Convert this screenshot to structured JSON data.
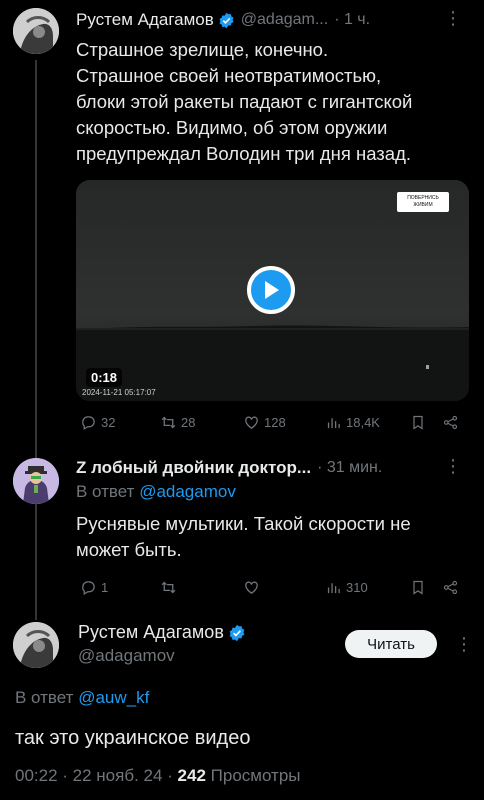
{
  "tweet1": {
    "author": "Рустем Адагамов",
    "handle": "@adagam...",
    "time": "· 1 ч.",
    "text_lines": [
      "Страшное зрелище, конечно.",
      "Страшное своей неотвратимостью,",
      "блоки этой ракеты падают с гигантской",
      "скоростью. Видимо, об этом оружии",
      "предупреждал Володин три дня назад."
    ],
    "video": {
      "duration": "0:18",
      "timestamp": "2024-11-21 05:17:07",
      "watermark_line1": "ПОВЕРНИСЬ",
      "watermark_line2": "ЖИВИМ"
    },
    "stats": {
      "replies": "32",
      "reposts": "28",
      "likes": "128",
      "views": "18,4K"
    }
  },
  "tweet2": {
    "author": "Z лобный двойник доктор...",
    "time": "· 31 мин.",
    "reply_prefix": "В ответ",
    "reply_to": "@adagamov",
    "text_lines": [
      "Руснявые мультики. Такой скорости не",
      "может быть."
    ],
    "stats": {
      "replies": "1",
      "reposts": "",
      "likes": "",
      "views": "310"
    }
  },
  "tweet3": {
    "author": "Рустем Адагамов",
    "handle": "@adagamov",
    "follow_label": "Читать",
    "reply_prefix": "В ответ",
    "reply_to": "@auw_kf",
    "text": "так это украинское видео",
    "meta_time": "00:22 · 22 нояб. 24 ·",
    "meta_views_count": "242",
    "meta_views_label": "Просмотры"
  },
  "colors": {
    "background": "#000000",
    "text": "#e7e9ea",
    "muted": "#71767b",
    "accent": "#1d9bf0"
  }
}
